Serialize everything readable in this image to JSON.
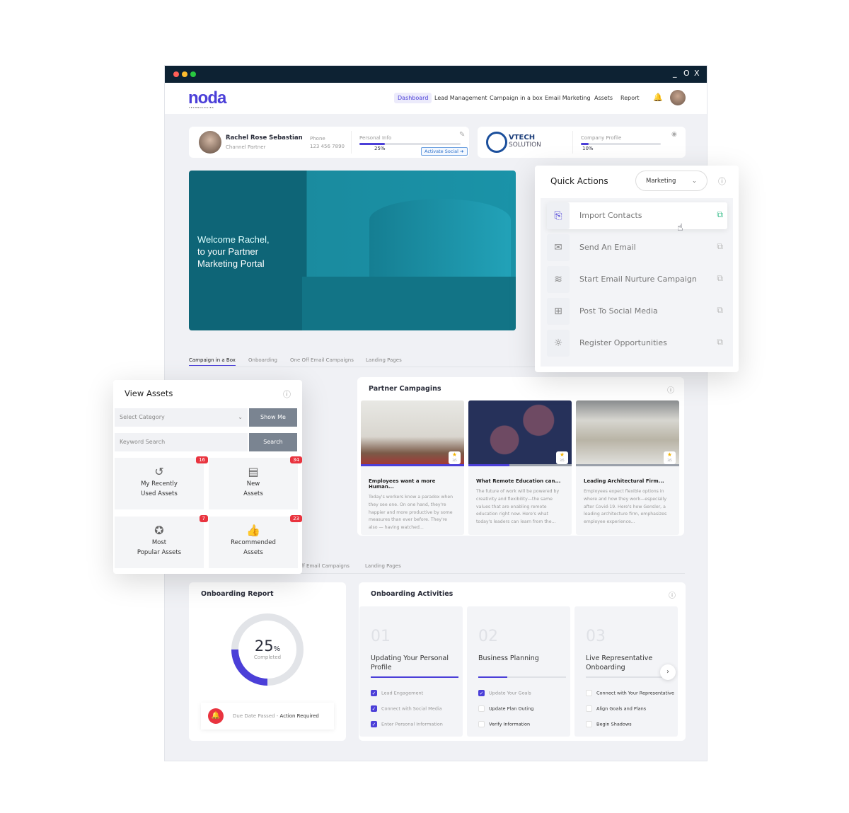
{
  "window": {
    "controls": [
      "_",
      "O",
      "X"
    ]
  },
  "nav": {
    "logo": "noda",
    "logo_sub": "TECHNOLOGIES",
    "items": [
      "Dashboard",
      "Lead Management",
      "Campaign in a box",
      "Email Marketing",
      "Assets",
      "Report"
    ],
    "active": "Dashboard"
  },
  "profile": {
    "name": "Rachel Rose Sebastian",
    "role": "Channel Partner",
    "phone_label": "Phone",
    "phone": "123 456 7890",
    "personal_info_label": "Personal Info",
    "personal_info_progress": 25,
    "personal_info_pct": "25%",
    "activate_button": "Activate Social"
  },
  "company": {
    "name_line1": "VTECH",
    "name_line2": "SOLUTION",
    "profile_label": "Company Profile",
    "profile_progress": 10,
    "profile_pct": "10%"
  },
  "hero": {
    "line1": "Welcome Rachel,",
    "line2": "to your Partner",
    "line3": "Marketing Portal"
  },
  "tabs": {
    "items": [
      "Campaign in a Box",
      "Onboarding",
      "One Off Email Campaigns",
      "Landing Pages"
    ],
    "active": "Campaign in a Box"
  },
  "tabs2": {
    "items": [
      "ff Email Campaigns",
      "Landing Pages"
    ]
  },
  "quick_actions": {
    "title": "Quick Actions",
    "dropdown": "Marketing",
    "items": [
      {
        "label": "Import Contacts",
        "icon": "import-icon"
      },
      {
        "label": "Send An Email",
        "icon": "envelope-icon"
      },
      {
        "label": "Start Email Nurture Campaign",
        "icon": "layers-icon"
      },
      {
        "label": "Post To Social Media",
        "icon": "post-icon"
      },
      {
        "label": "Register Opportunities",
        "icon": "lightbulb-icon"
      }
    ]
  },
  "view_assets": {
    "title": "View Assets",
    "select_placeholder": "Select Category",
    "show_me": "Show Me",
    "keyword_placeholder": "Keyword Search",
    "search": "Search",
    "tiles": [
      {
        "line1": "My Recently",
        "line2": "Used Assets",
        "count": "16",
        "icon": "history-icon"
      },
      {
        "line1": "New",
        "line2": "Assets",
        "count": "34",
        "icon": "document-icon"
      },
      {
        "line1": "Most",
        "line2": "Popular Assets",
        "count": "7",
        "icon": "badge-check-icon"
      },
      {
        "line1": "Recommended",
        "line2": "Assets",
        "count": "23",
        "icon": "thumbs-up-icon"
      }
    ]
  },
  "partner_campaigns": {
    "title": "Partner Campagins",
    "cards": [
      {
        "title": "Employees want a more Human...",
        "desc": "Today's workers know a paradox when they see one. On one hand, they're happier and more productive by some measures than ever before. They're also — having watched...",
        "rating": "3/5",
        "progress": 100
      },
      {
        "title": "What Remote Education can...",
        "desc": "The future of work will be powered by creativity and flexibility—the same values that are enabling remote education right now. Here's what today's leaders can learn from the...",
        "rating": "3/5",
        "progress": 40
      },
      {
        "title": "Leading Architectural Firm...",
        "desc": "Employees expect flexible options in where and how they work—especially after Covid-19. Here's how Gensler, a leading architecture firm, emphasizes employee experience...",
        "rating": "3/5",
        "progress": 0
      }
    ]
  },
  "onboarding_report": {
    "title": "Onboarding Report",
    "percent": "25",
    "percent_sign": "%",
    "completed": "Completed",
    "progress": 25,
    "alert_text": "Due Date Passed - ",
    "alert_strong": "Action Required"
  },
  "onboarding_activities": {
    "title": "Onboarding Activities",
    "steps": [
      {
        "num": "01",
        "title": "Updating Your Personal Profile",
        "progress": 100,
        "tasks": [
          {
            "label": "Lead Engagement",
            "done": true
          },
          {
            "label": "Connect with Social Media",
            "done": true
          },
          {
            "label": "Enter Personal Information",
            "done": true
          }
        ]
      },
      {
        "num": "02",
        "title": "Business Planning",
        "progress": 33,
        "tasks": [
          {
            "label": "Update Your Goals",
            "done": true
          },
          {
            "label": "Update Plan Outing",
            "done": false
          },
          {
            "label": "Verify Information",
            "done": false
          }
        ]
      },
      {
        "num": "03",
        "title": "Live Representative Onboarding",
        "progress": 0,
        "tasks": [
          {
            "label": "Connect with Your Representative",
            "done": false
          },
          {
            "label": "Align Goals and Plans",
            "done": false
          },
          {
            "label": "Begin Shadows",
            "done": false
          }
        ]
      }
    ]
  },
  "colors": {
    "accent": "#4b3fd8",
    "titlebar": "#0d2233",
    "hero": "#0e6577",
    "badge": "#e9343f"
  }
}
